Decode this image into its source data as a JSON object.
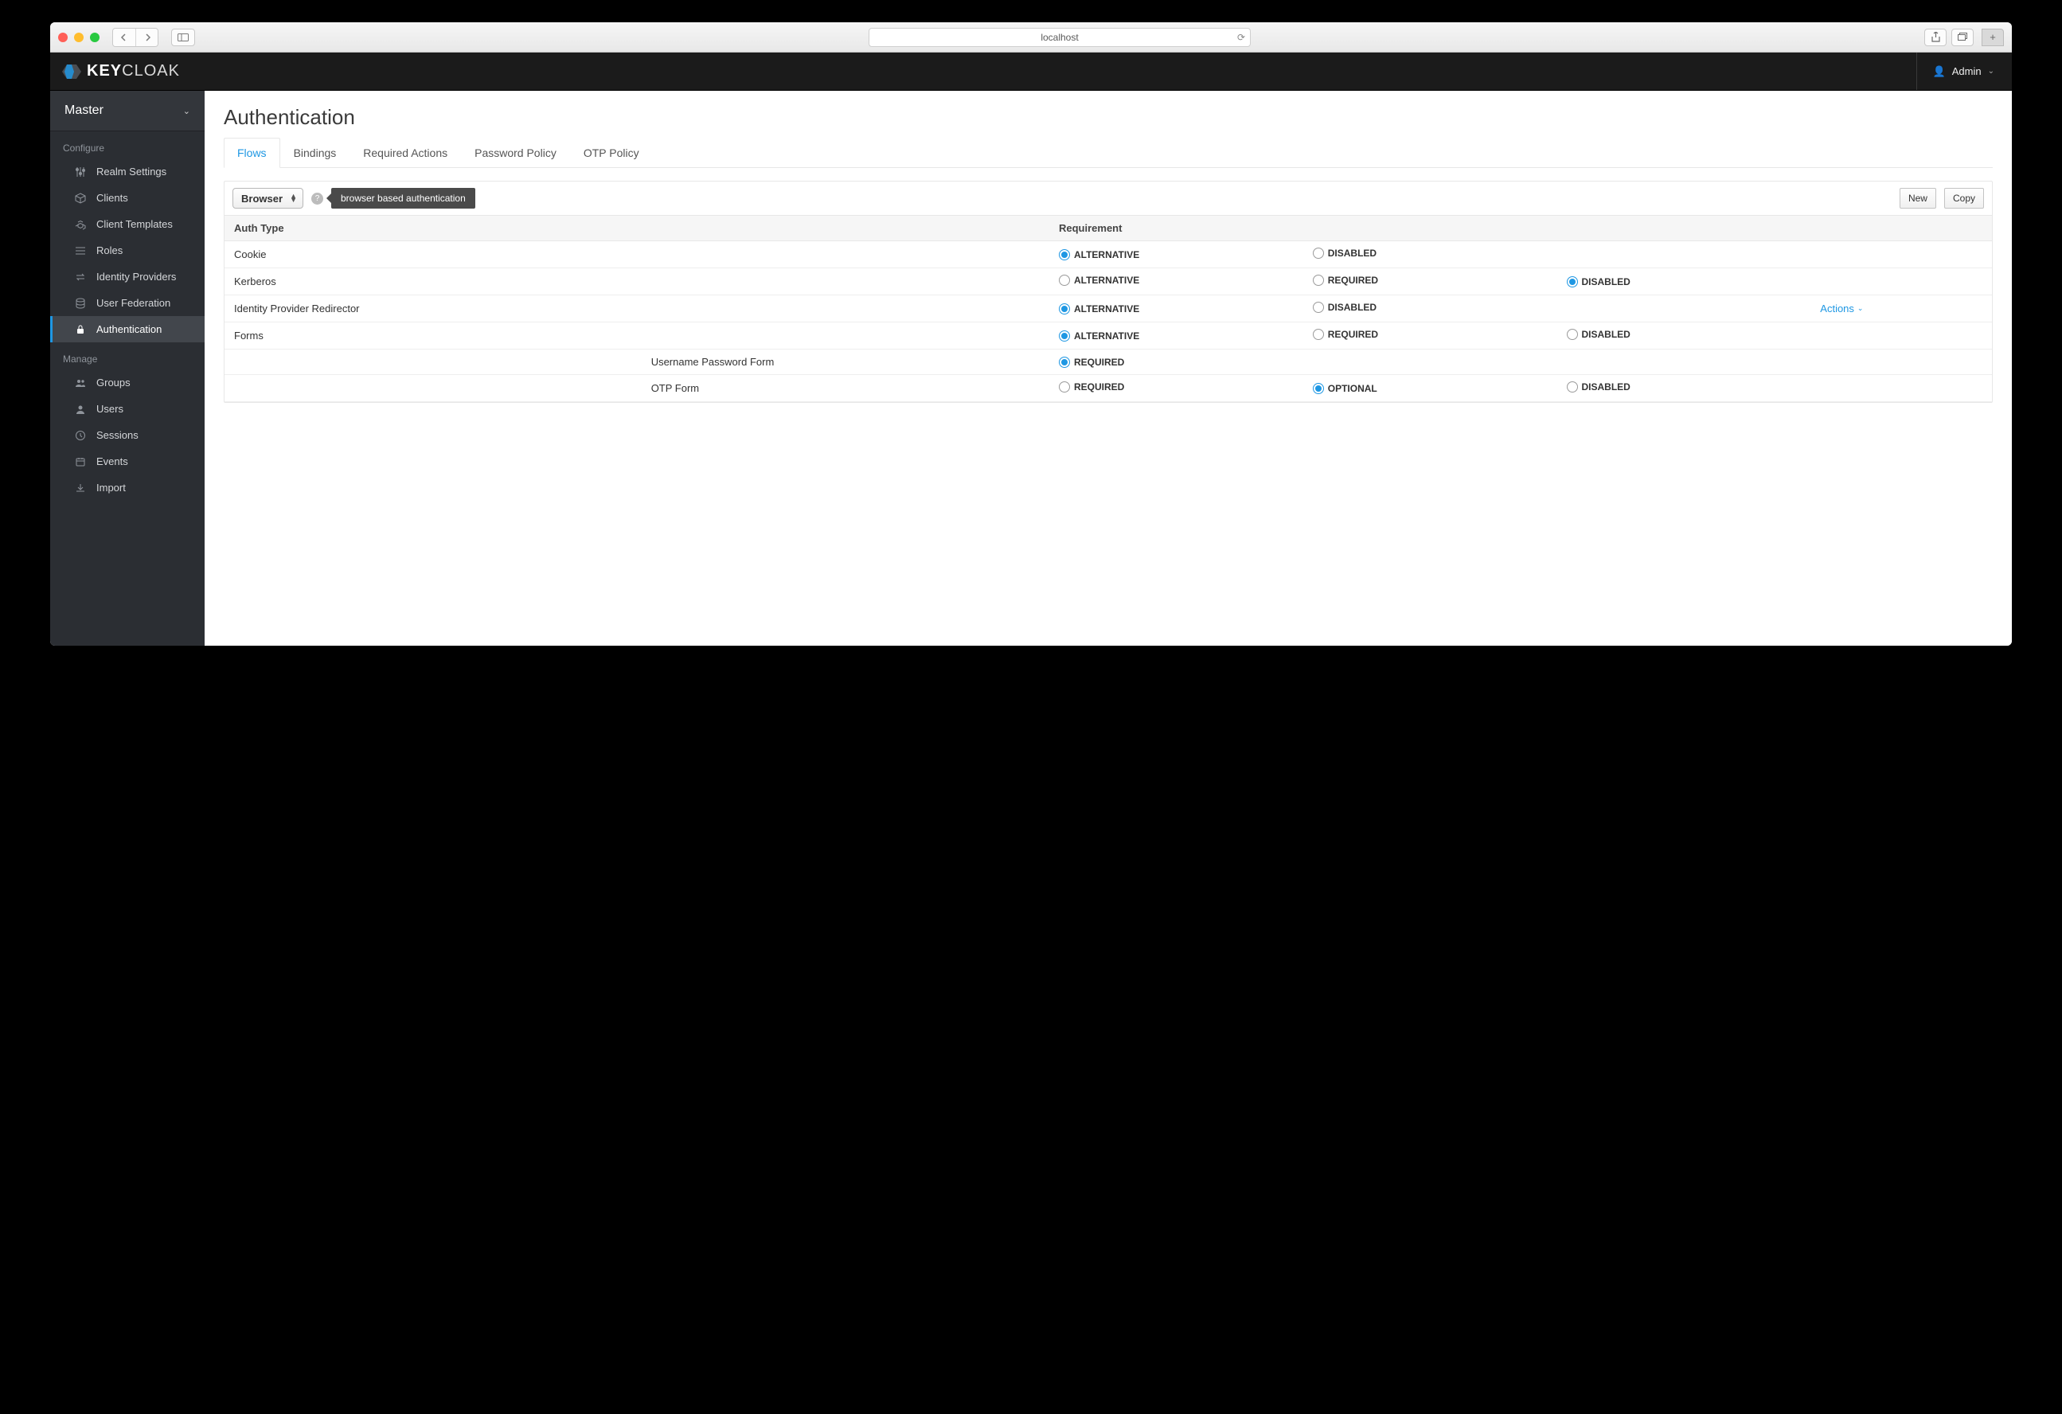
{
  "browser": {
    "url": "localhost"
  },
  "header": {
    "user": "Admin"
  },
  "realm": {
    "name": "Master"
  },
  "sidebar": {
    "configure_title": "Configure",
    "manage_title": "Manage",
    "configure": [
      {
        "label": "Realm Settings",
        "icon": "sliders"
      },
      {
        "label": "Clients",
        "icon": "cube"
      },
      {
        "label": "Client Templates",
        "icon": "cubes"
      },
      {
        "label": "Roles",
        "icon": "list"
      },
      {
        "label": "Identity Providers",
        "icon": "exchange"
      },
      {
        "label": "User Federation",
        "icon": "database"
      },
      {
        "label": "Authentication",
        "icon": "lock"
      }
    ],
    "manage": [
      {
        "label": "Groups",
        "icon": "group"
      },
      {
        "label": "Users",
        "icon": "user"
      },
      {
        "label": "Sessions",
        "icon": "clock"
      },
      {
        "label": "Events",
        "icon": "calendar"
      },
      {
        "label": "Import",
        "icon": "import"
      }
    ]
  },
  "page": {
    "title": "Authentication",
    "tabs": [
      "Flows",
      "Bindings",
      "Required Actions",
      "Password Policy",
      "OTP Policy"
    ],
    "active_tab": "Flows"
  },
  "flows": {
    "selected": "Browser",
    "tooltip": "browser based authentication",
    "buttons": {
      "new": "New",
      "copy": "Copy"
    },
    "columns": {
      "auth_type": "Auth Type",
      "requirement": "Requirement"
    },
    "actions_label": "Actions",
    "rows": [
      {
        "name": "Cookie",
        "sub": "",
        "opts": [
          {
            "label": "ALTERNATIVE",
            "checked": true
          },
          {
            "label": "DISABLED",
            "checked": false
          }
        ],
        "c3": null,
        "actions": false
      },
      {
        "name": "Kerberos",
        "sub": "",
        "opts": [
          {
            "label": "ALTERNATIVE",
            "checked": false
          },
          {
            "label": "REQUIRED",
            "checked": false
          }
        ],
        "c3": {
          "label": "DISABLED",
          "checked": true
        },
        "actions": false
      },
      {
        "name": "Identity Provider Redirector",
        "sub": "",
        "opts": [
          {
            "label": "ALTERNATIVE",
            "checked": true
          },
          {
            "label": "DISABLED",
            "checked": false
          }
        ],
        "c3": null,
        "actions": true
      },
      {
        "name": "Forms",
        "sub": "",
        "opts": [
          {
            "label": "ALTERNATIVE",
            "checked": true
          },
          {
            "label": "REQUIRED",
            "checked": false
          }
        ],
        "c3": {
          "label": "DISABLED",
          "checked": false
        },
        "actions": false
      },
      {
        "name": "",
        "sub": "Username Password Form",
        "opts": [
          {
            "label": "REQUIRED",
            "checked": true
          }
        ],
        "c3": null,
        "actions": false
      },
      {
        "name": "",
        "sub": "OTP Form",
        "opts": [
          {
            "label": "REQUIRED",
            "checked": false
          },
          {
            "label": "OPTIONAL",
            "checked": true
          }
        ],
        "c3": {
          "label": "DISABLED",
          "checked": false
        },
        "actions": false
      }
    ]
  }
}
